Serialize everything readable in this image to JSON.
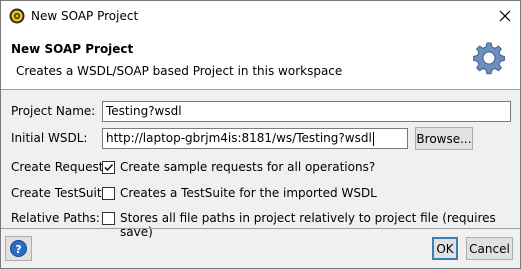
{
  "window": {
    "title": "New SOAP Project",
    "close_label": "✕"
  },
  "header": {
    "title": "New SOAP Project",
    "subtitle": "Creates a WSDL/SOAP based Project in this workspace",
    "icon": "gear-icon"
  },
  "form": {
    "project_name_label": "Project Name:",
    "project_name_value": "Testing?wsdl",
    "initial_wsdl_label": "Initial WSDL:",
    "initial_wsdl_value": "http://laptop-gbrjm4is:8181/ws/Testing?wsdl",
    "browse_label": "Browse...",
    "create_requests_label": "Create Requests:",
    "create_requests_text": "Create sample requests for all operations?",
    "create_requests_checked": true,
    "create_testsuite_label": "Create TestSuite:",
    "create_testsuite_text": "Creates a TestSuite for the imported WSDL",
    "create_testsuite_checked": false,
    "relative_paths_label": "Relative Paths:",
    "relative_paths_text": "Stores all file paths in project relatively to project file (requires save)",
    "relative_paths_checked": false
  },
  "footer": {
    "ok_label": "OK",
    "cancel_label": "Cancel",
    "help_icon": "help-icon"
  },
  "colors": {
    "accent": "#3c7fb1",
    "help_blue": "#2a6cc4",
    "gear_blue": "#5a7fb0"
  }
}
